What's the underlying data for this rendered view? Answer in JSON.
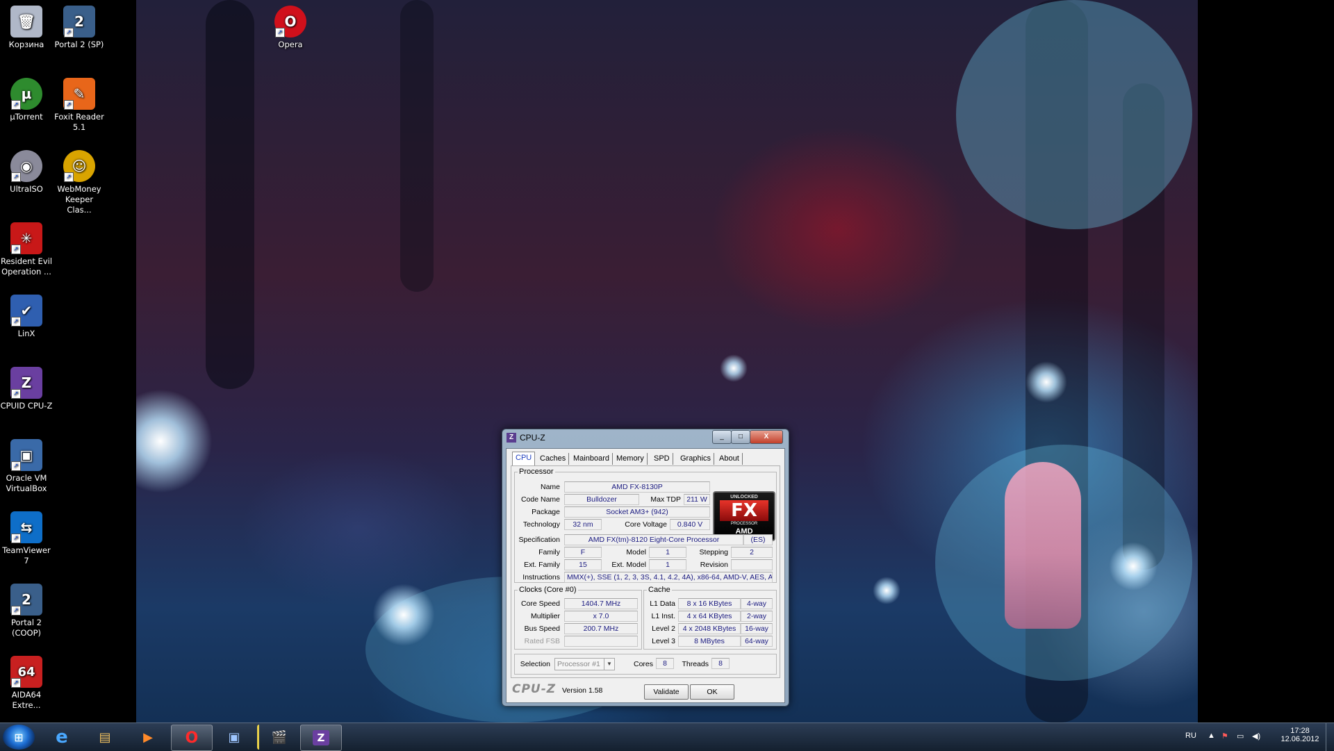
{
  "desktop_icons": [
    {
      "id": "recycle",
      "label": "Корзина",
      "icon": "recycle-bin-icon",
      "color": "#b0b8c8",
      "glyph": "🗑"
    },
    {
      "id": "portal2sp",
      "label": "Portal 2 (SP)",
      "icon": "portal2-icon",
      "color": "#3a5f8a",
      "glyph": "2"
    },
    {
      "id": "opera",
      "label": "Opera",
      "icon": "opera-icon",
      "color": "#d0101b",
      "glyph": "O"
    },
    {
      "id": "utorrent",
      "label": "µTorrent",
      "icon": "utorrent-icon",
      "color": "#2e8b2e",
      "glyph": "µ"
    },
    {
      "id": "foxit",
      "label": "Foxit Reader 5.1",
      "icon": "foxit-reader-icon",
      "color": "#e8661a",
      "glyph": "✎"
    },
    {
      "id": "ultraiso",
      "label": "UltraISO",
      "icon": "ultraiso-disc-icon",
      "color": "#8a8a9a",
      "glyph": "◉"
    },
    {
      "id": "webmoney",
      "label": "WebMoney Keeper Clas...",
      "icon": "webmoney-icon",
      "color": "#d9a400",
      "glyph": "☺"
    },
    {
      "id": "resident",
      "label": "Resident Evil Operation ...",
      "icon": "umbrella-icon",
      "color": "#c81818",
      "glyph": "✳"
    },
    {
      "id": "linx",
      "label": "LinX",
      "icon": "linx-checkmark-icon",
      "color": "#2f5fb0",
      "glyph": "✔"
    },
    {
      "id": "cpuz",
      "label": "CPUID CPU-Z",
      "icon": "cpuz-icon",
      "color": "#6a3fa0",
      "glyph": "Z"
    },
    {
      "id": "vbox",
      "label": "Oracle VM VirtualBox",
      "icon": "virtualbox-icon",
      "color": "#3a6aa8",
      "glyph": "▣"
    },
    {
      "id": "teamviewer",
      "label": "TeamViewer 7",
      "icon": "teamviewer-icon",
      "color": "#0e6ec8",
      "glyph": "⇆"
    },
    {
      "id": "portal2coop",
      "label": "Portal 2 (COOP)",
      "icon": "portal2-icon",
      "color": "#3a5f8a",
      "glyph": "2"
    },
    {
      "id": "aida",
      "label": "AIDA64 Extre...",
      "icon": "aida64-icon",
      "color": "#c82020",
      "glyph": "64"
    }
  ],
  "cpuz": {
    "title": "CPU-Z",
    "window_buttons": {
      "minimize": "_",
      "maximize": "□",
      "close": "X"
    },
    "tabs": [
      "CPU",
      "Caches",
      "Mainboard",
      "Memory",
      "SPD",
      "Graphics",
      "About"
    ],
    "active_tab": "CPU",
    "processor": {
      "legend": "Processor",
      "name_label": "Name",
      "name": "AMD FX-8130P",
      "codename_label": "Code Name",
      "codename": "Bulldozer",
      "maxtdp_label": "Max TDP",
      "maxtdp": "211 W",
      "package_label": "Package",
      "package": "Socket AM3+ (942)",
      "technology_label": "Technology",
      "technology": "32 nm",
      "corevoltage_label": "Core Voltage",
      "corevoltage": "0.840 V",
      "spec_label": "Specification",
      "spec": "AMD FX(tm)-8120 Eight-Core Processor",
      "spec_es": "(ES)",
      "family_label": "Family",
      "family": "F",
      "model_label": "Model",
      "model": "1",
      "stepping_label": "Stepping",
      "stepping": "2",
      "extfamily_label": "Ext. Family",
      "extfamily": "15",
      "extmodel_label": "Ext. Model",
      "extmodel": "1",
      "revision_label": "Revision",
      "revision": "",
      "instructions_label": "Instructions",
      "instructions": "MMX(+), SSE (1, 2, 3, 3S, 4.1, 4.2, 4A), x86-64, AMD-V, AES, A"
    },
    "logo": {
      "unlocked": "UNLOCKED",
      "fx": "FX",
      "processor": "PROCESSOR",
      "brand": "AMD"
    },
    "clocks": {
      "legend": "Clocks (Core #0)",
      "corespeed_label": "Core Speed",
      "corespeed": "1404.7 MHz",
      "multiplier_label": "Multiplier",
      "multiplier": "x 7.0",
      "busspeed_label": "Bus Speed",
      "busspeed": "200.7 MHz",
      "ratedfsb_label": "Rated FSB",
      "ratedfsb": ""
    },
    "cache": {
      "legend": "Cache",
      "rows": [
        {
          "label": "L1 Data",
          "size": "8 x 16 KBytes",
          "way": "4-way"
        },
        {
          "label": "L1 Inst.",
          "size": "4 x 64 KBytes",
          "way": "2-way"
        },
        {
          "label": "Level 2",
          "size": "4 x 2048 KBytes",
          "way": "16-way"
        },
        {
          "label": "Level 3",
          "size": "8 MBytes",
          "way": "64-way"
        }
      ]
    },
    "selection_label": "Selection",
    "selection": "Processor #1",
    "cores_label": "Cores",
    "cores": "8",
    "threads_label": "Threads",
    "threads": "8",
    "footer_logo": "CPU-Z",
    "version": "Version 1.58",
    "validate_label": "Validate",
    "ok_label": "OK"
  },
  "taskbar": {
    "apps": [
      {
        "id": "ie",
        "icon": "internet-explorer-icon",
        "glyph": "e",
        "running": false
      },
      {
        "id": "explorer",
        "icon": "folder-icon",
        "glyph": "▤",
        "running": false
      },
      {
        "id": "media",
        "icon": "media-player-icon",
        "glyph": "▶",
        "running": false
      },
      {
        "id": "opera",
        "icon": "opera-icon",
        "glyph": "O",
        "running": true
      },
      {
        "id": "vbox",
        "icon": "virtualbox-icon",
        "glyph": "▣",
        "running": false
      },
      {
        "id": "clapper",
        "icon": "video-editor-icon",
        "glyph": "🎬",
        "running": false
      },
      {
        "id": "cpuz",
        "icon": "cpuz-icon",
        "glyph": "Z",
        "running": true
      }
    ],
    "language": "RU",
    "time": "17:28",
    "date": "12.06.2012"
  }
}
